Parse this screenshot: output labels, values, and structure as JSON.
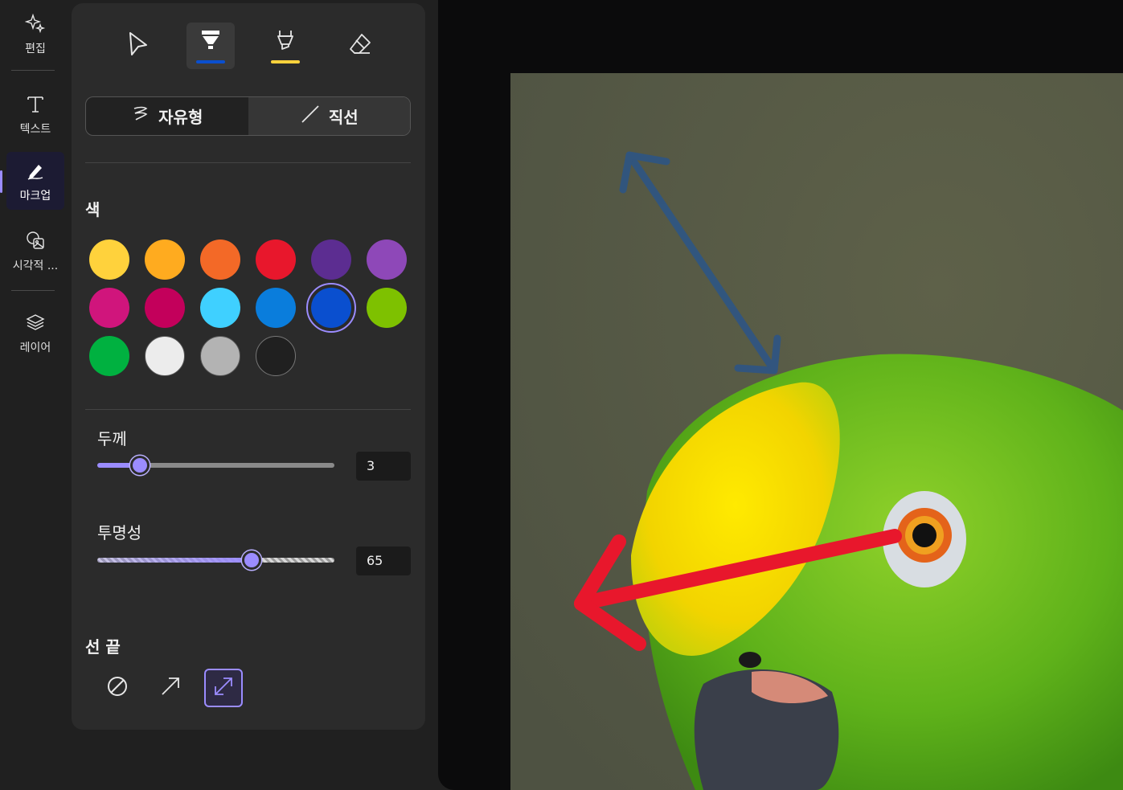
{
  "rail": {
    "items": [
      {
        "label": "편집",
        "icon": "sparkle-icon"
      },
      {
        "label": "텍스트",
        "icon": "text-icon"
      },
      {
        "label": "마크업",
        "icon": "pen-icon",
        "active": true
      },
      {
        "label": "시각적 ...",
        "icon": "visual-icon"
      },
      {
        "label": "레이어",
        "icon": "layers-icon"
      }
    ]
  },
  "panel": {
    "tools": [
      {
        "name": "select",
        "icon": "pointer-icon"
      },
      {
        "name": "pen",
        "icon": "pen-tip-icon",
        "active": true,
        "color": "#0a4fcf"
      },
      {
        "name": "highlighter",
        "icon": "highlighter-icon",
        "color": "#ffd23c"
      },
      {
        "name": "eraser",
        "icon": "eraser-icon"
      }
    ],
    "modes": [
      {
        "label": "자유형",
        "icon": "freeform-icon"
      },
      {
        "label": "직선",
        "icon": "line-icon",
        "active": true
      }
    ],
    "color_title": "색",
    "colors": [
      "#ffd23c",
      "#ffab1f",
      "#f36927",
      "#e8172c",
      "#5c2d91",
      "#8e48b8",
      "#d0157c",
      "#c3005b",
      "#3fd0ff",
      "#0a7ddc",
      "#0a4fcf",
      "#7ec100",
      "#00b140",
      "#ececec",
      "#b3b3b3",
      "#202020"
    ],
    "selected_color": "#0a4fcf",
    "thickness_label": "두께",
    "thickness_value": "3",
    "thickness_fraction": 0.18,
    "opacity_label": "투명성",
    "opacity_value": "65",
    "opacity_fraction": 0.65,
    "line_end_title": "선 끝",
    "line_ends": [
      {
        "name": "none",
        "icon": "none-icon"
      },
      {
        "name": "single-arrow",
        "icon": "arrow-up-right-icon"
      },
      {
        "name": "double-arrow",
        "icon": "double-arrow-icon",
        "active": true
      }
    ],
    "accent": "#9b8cff"
  },
  "canvas": {
    "annotations": [
      {
        "type": "double-arrow",
        "color": "#2e5584"
      },
      {
        "type": "arrow",
        "color": "#e8172c"
      }
    ]
  }
}
